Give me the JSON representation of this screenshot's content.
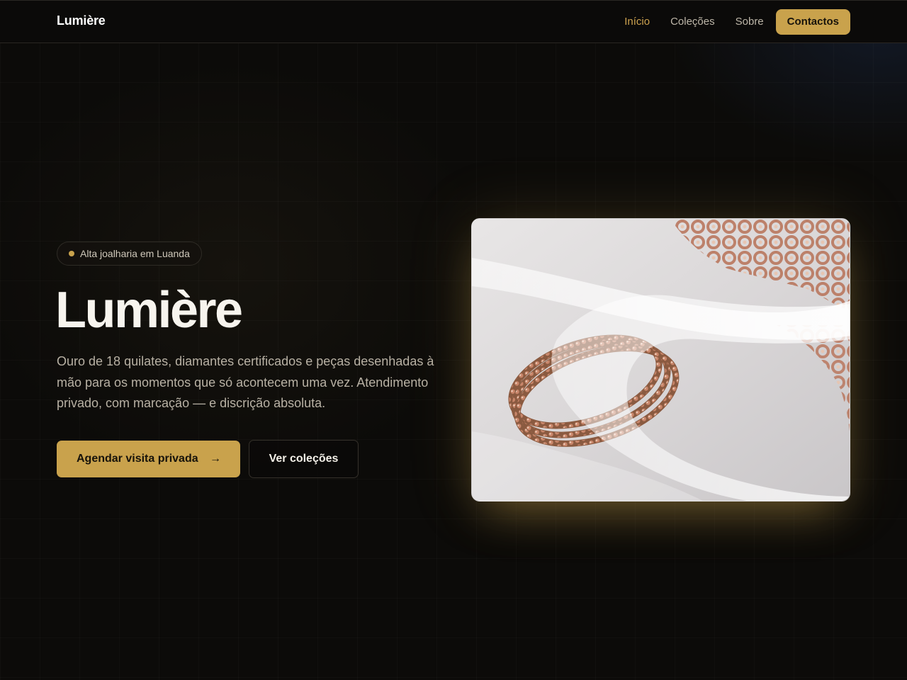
{
  "nav": {
    "brand": "Lumière",
    "links": [
      {
        "label": "Início",
        "active": true
      },
      {
        "label": "Coleções",
        "active": false
      },
      {
        "label": "Sobre",
        "active": false
      }
    ],
    "cta_label": "Contactos"
  },
  "hero": {
    "badge": "Alta joalharia em Luanda",
    "title": "Lumière",
    "description": "Ouro de 18 quilates, diamantes certificados e peças desenhadas à mão para os momentos que só acontecem uma vez. Atendimento privado, com marcação — e discrição absoluta.",
    "primary_button": "Agendar visita privada",
    "primary_button_icon": "arrow-right-icon",
    "secondary_button": "Ver coleções"
  },
  "colors": {
    "accent": "#c9a24c",
    "background": "#0c0b09",
    "text": "#f3efe7",
    "muted_text": "#b8b1a4"
  }
}
